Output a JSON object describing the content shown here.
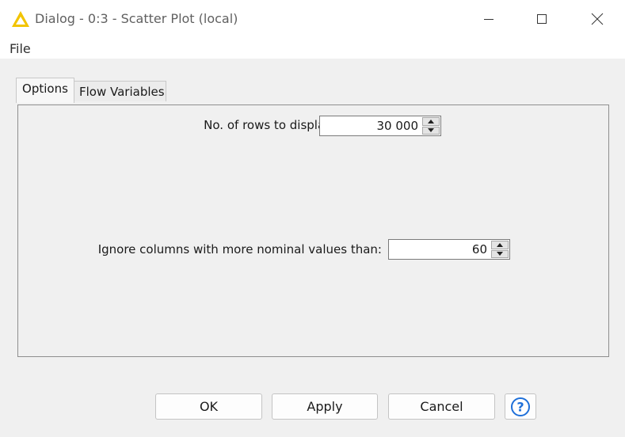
{
  "window": {
    "title": "Dialog - 0:3 - Scatter Plot (local)",
    "icon": "knime-warning-triangle-icon",
    "controls": {
      "minimize": "minimize-icon",
      "maximize": "maximize-icon",
      "close": "close-icon"
    }
  },
  "menu": {
    "file": "File"
  },
  "tabs": [
    {
      "label": "Options",
      "selected": true
    },
    {
      "label": "Flow Variables",
      "selected": false
    }
  ],
  "options": {
    "rows_label": "No. of rows to display:",
    "rows_value": "30 000",
    "nominal_label": "Ignore columns with more nominal values than:",
    "nominal_value": "60"
  },
  "buttons": {
    "ok": "OK",
    "apply": "Apply",
    "cancel": "Cancel",
    "help": "help-question-icon"
  },
  "colors": {
    "accent": "#f2c400",
    "help_blue": "#1e6fd9"
  }
}
